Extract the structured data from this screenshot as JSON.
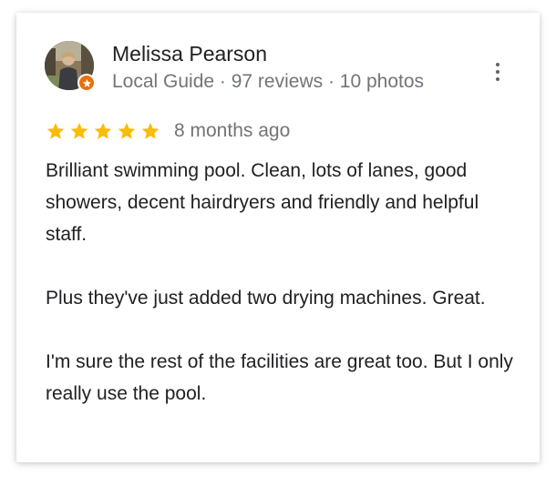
{
  "reviewer": {
    "name": "Melissa Pearson",
    "meta": "Local Guide · 97 reviews · 10 photos",
    "avatar_icon": "user-photo",
    "badge_icon": "local-guide-star-icon",
    "badge_color": "#e8710a"
  },
  "more_icon": "more-vert-icon",
  "rating": {
    "stars": 5,
    "max_stars": 5,
    "star_color": "#fbbc04",
    "date": "8 months ago"
  },
  "review": {
    "paragraphs": [
      "Brilliant swimming pool. Clean, lots of lanes, good showers, decent hairdryers and friendly and helpful staff.",
      "Plus they've just added two drying machines. Great.",
      "I'm sure the rest of the facilities are great too. But I only really use the pool."
    ]
  }
}
